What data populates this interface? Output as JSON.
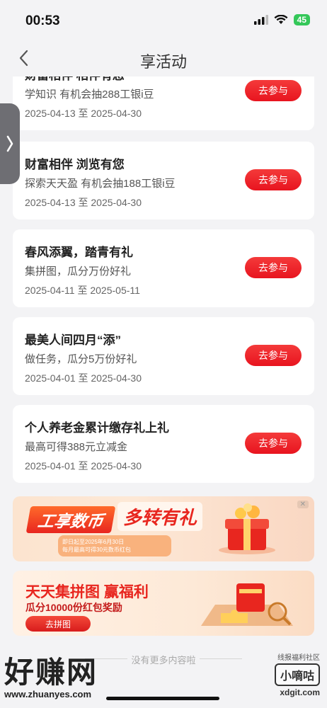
{
  "status_bar": {
    "time": "00:53",
    "battery": "45"
  },
  "header": {
    "title": "享活动"
  },
  "activities": [
    {
      "title": "财富相伴 相伴有您",
      "subtitle": "学知识 有机会抽288工银i豆",
      "date": "2025-04-13 至 2025-04-30",
      "button": "去参与"
    },
    {
      "title": "财富相伴 浏览有您",
      "subtitle": "探索天天盈 有机会抽188工银i豆",
      "date": "2025-04-13 至 2025-04-30",
      "button": "去参与"
    },
    {
      "title": "春风添翼，踏青有礼",
      "subtitle": "集拼图，瓜分万份好礼",
      "date": "2025-04-11 至 2025-05-11",
      "button": "去参与"
    },
    {
      "title": "最美人间四月“添”",
      "subtitle": "做任务，瓜分5万份好礼",
      "date": "2025-04-01 至 2025-04-30",
      "button": "去参与"
    },
    {
      "title": "个人养老金累计缴存礼上礼",
      "subtitle": "最高可得388元立减金",
      "date": "2025-04-01 至 2025-04-30",
      "button": "去参与"
    }
  ],
  "banner1": {
    "title_left": "工享数币",
    "title_right": "多转有礼",
    "line1": "即日起至2025年6月30日",
    "line2": "每月最高可得30元数币红包"
  },
  "banner2": {
    "title": "天天集拼图 赢福利",
    "subtitle": "瓜分10000份红包奖励",
    "button": "去拼图"
  },
  "footer": {
    "end_text": "没有更多内容啦"
  },
  "watermarks": {
    "left_big": "好赚网",
    "left_url": "www.zhuanyes.com",
    "right_small": "线报福利社区",
    "right_box": "小嘀咕",
    "right_url": "xdgit.com"
  },
  "colors": {
    "accent": "#e8141f",
    "page_bg": "#f3f3f5"
  }
}
